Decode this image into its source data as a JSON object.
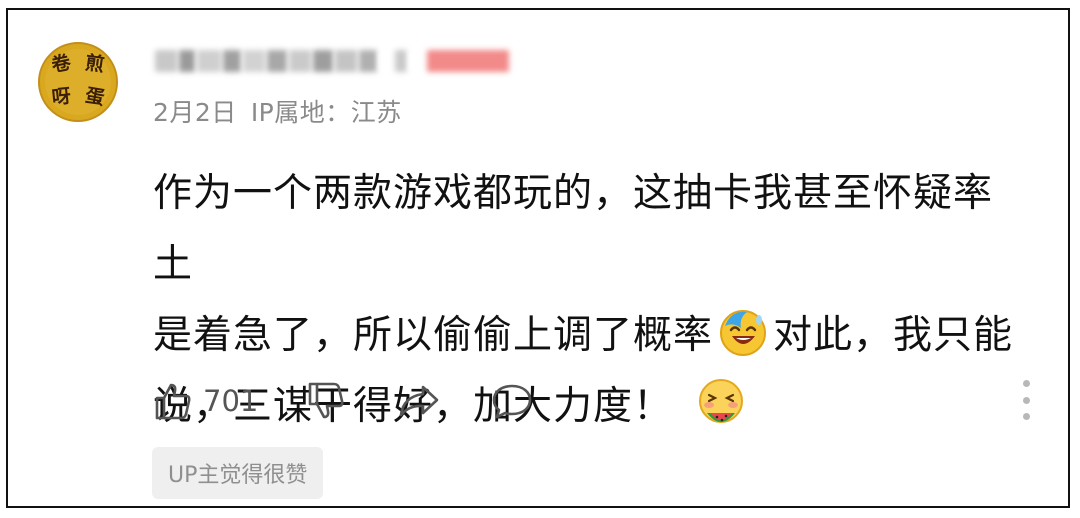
{
  "comment": {
    "avatar_chars": [
      "卷",
      "煎",
      "呀",
      "蛋"
    ],
    "username_blocks": [
      {
        "w": 22,
        "color": "#c8c8c8"
      },
      {
        "w": 16,
        "color": "#9a9a9a"
      },
      {
        "w": 24,
        "color": "#cfcfcf"
      },
      {
        "w": 18,
        "color": "#a0a0a0"
      },
      {
        "w": 22,
        "color": "#d2d2d2"
      },
      {
        "w": 20,
        "color": "#a8a8a8"
      },
      {
        "w": 22,
        "color": "#cacaca"
      },
      {
        "w": 20,
        "color": "#9e9e9e"
      },
      {
        "w": 22,
        "color": "#c4c4c4"
      },
      {
        "w": 18,
        "color": "#b0b0b0"
      },
      {
        "w": 14,
        "color": "#ffffff"
      },
      {
        "w": 12,
        "color": "#c9c9c9"
      },
      {
        "w": 16,
        "color": "#ffffff"
      },
      {
        "w": 82,
        "color": "#f28a8a"
      }
    ],
    "date": "2月2日",
    "ip_location": "IP属地：江苏",
    "text_line1": "作为一个两款游戏都玩的，这抽卡我甚至怀疑率土",
    "text_line2a": "是着急了，所以偷偷上调了概率",
    "emoji_1": "laughing-sweat-emoji",
    "text_line2b": "对此，我只能",
    "text_line3": "说，三谋干得好，加大力度！",
    "emoji_2": "eating-watermelon-emoji",
    "like_count": "701",
    "up_badge": "UP主觉得很赞"
  },
  "colors": {
    "text": "#111111",
    "meta": "#8a8a8a",
    "icon": "#555555",
    "badge_bg": "#efefef",
    "avatar_gold": "#d9a81e"
  },
  "icons": [
    "thumb-up-icon",
    "thumb-down-icon",
    "share-icon",
    "comment-icon",
    "more-vertical-icon"
  ]
}
